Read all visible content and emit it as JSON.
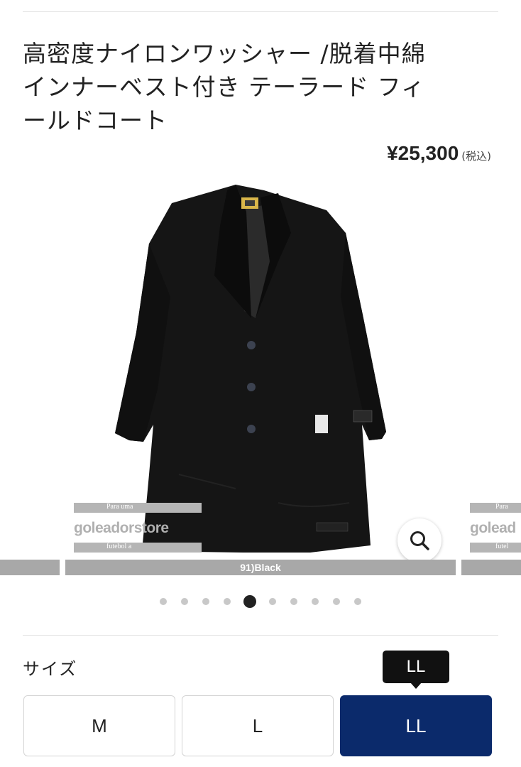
{
  "product": {
    "title_lines": [
      "高密度ナイロンワッシャー /脱着中綿",
      "インナーベスト付き テーラード フィ",
      "ールドコート"
    ],
    "price": "¥25,300",
    "tax_note": "(税込)"
  },
  "gallery": {
    "caption": "91)Black",
    "watermark": {
      "top_text": "Para uma",
      "logo_text": "goleador",
      "logo_suffix": "store",
      "bottom_text": "futebol a",
      "right_logo_text": "golead",
      "right_top_text": "Para",
      "right_bottom_text": "futel"
    },
    "zoom_icon": "search-icon",
    "dot_count": 10,
    "active_dot_index": 4
  },
  "size": {
    "label": "サイズ",
    "tooltip": "LL",
    "options": [
      {
        "label": "M",
        "selected": false
      },
      {
        "label": "L",
        "selected": false
      },
      {
        "label": "LL",
        "selected": true
      }
    ]
  },
  "colors": {
    "selected_bg": "#0b2a6b",
    "tooltip_bg": "#111111",
    "caption_bar": "#a8a8a8"
  }
}
